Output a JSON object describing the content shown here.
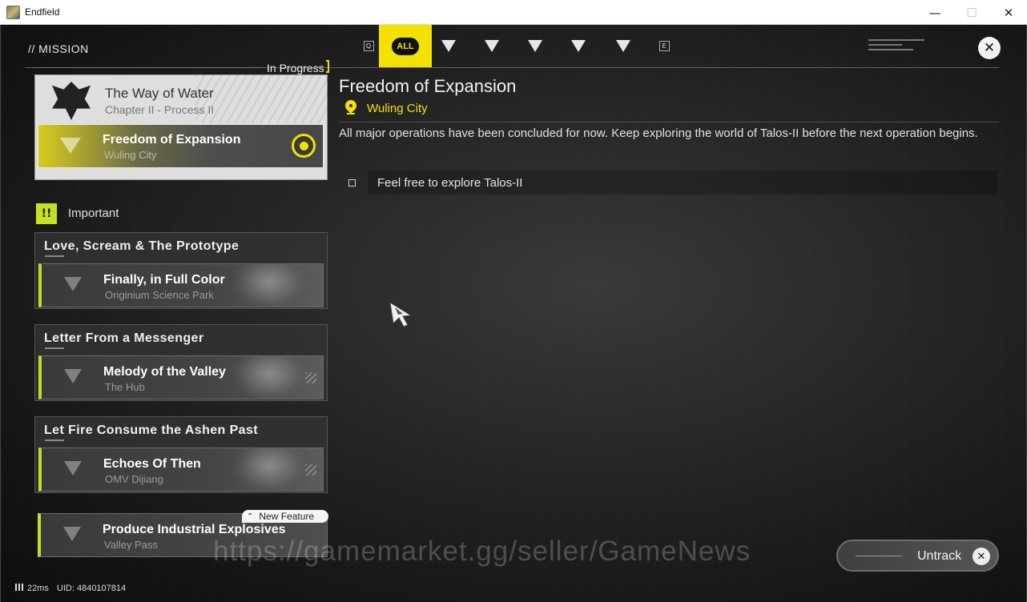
{
  "window": {
    "title": "Endfield"
  },
  "header": {
    "section_label": "// MISSION",
    "tabs": [
      {
        "id": "q",
        "label": "Q"
      },
      {
        "id": "all",
        "label": "ALL",
        "active": true
      },
      {
        "id": "type1",
        "icon": "chevron-triangle-icon"
      },
      {
        "id": "type2",
        "icon": "triangle-c-icon"
      },
      {
        "id": "type3",
        "icon": "triangle-bar-icon"
      },
      {
        "id": "type4",
        "icon": "triangle-star-icon"
      },
      {
        "id": "type5",
        "icon": "triangle-lines-icon"
      },
      {
        "id": "e",
        "label": "E"
      }
    ]
  },
  "in_progress": {
    "label": "In Progress",
    "chapter_title": "The Way of Water",
    "chapter_sub": "Chapter II - Process II",
    "active_mission": {
      "title": "Freedom of Expansion",
      "location": "Wuling City"
    }
  },
  "important": {
    "label": "Important",
    "groups": [
      {
        "title": "Love, Scream & The Prototype",
        "mission": {
          "title": "Finally, in Full Color",
          "location": "Originium Science Park"
        }
      },
      {
        "title": "Letter From a Messenger",
        "mission": {
          "title": "Melody of the Valley",
          "location": "The Hub"
        }
      },
      {
        "title": "Let Fire Consume the Ashen Past",
        "mission": {
          "title": "Echoes Of Then",
          "location": "OMV Dijiang"
        }
      }
    ],
    "feature": {
      "badge": "New Feature",
      "title": "Produce Industrial Explosives",
      "location": "Valley Pass"
    }
  },
  "detail": {
    "title": "Freedom of Expansion",
    "location": "Wuling City",
    "description": "All major operations have been concluded for now. Keep exploring the world of Talos-II before the next operation begins.",
    "objective": "Feel free to explore Talos-II"
  },
  "actions": {
    "untrack_label": "Untrack"
  },
  "status": {
    "ping": "22ms",
    "uid": "UID: 4840107814"
  },
  "watermark": "https://gamemarket.gg/seller/GameNews",
  "colors": {
    "accent_yellow": "#f3e100",
    "accent_green": "#bfe01d"
  }
}
